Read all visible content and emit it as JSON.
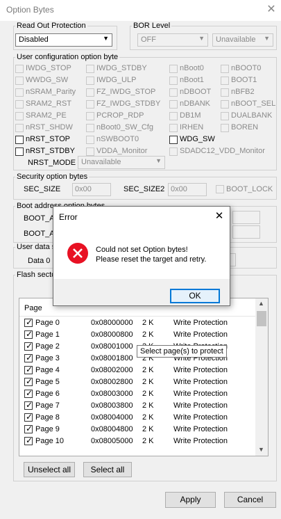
{
  "window": {
    "title": "Option Bytes",
    "close_glyph": "✕"
  },
  "read_out_protection": {
    "label": "Read Out Protection",
    "value": "Disabled"
  },
  "bor_level": {
    "label": "BOR Level",
    "value1": "OFF",
    "value2": "Unavailable"
  },
  "user_config": {
    "label": "User configuration option byte",
    "options": [
      "IWDG_STOP",
      "IWDG_STDBY",
      "nBoot0",
      "nBOOT0",
      "WWDG_SW",
      "IWDG_ULP",
      "nBoot1",
      "BOOT1",
      "nSRAM_Parity",
      "FZ_IWDG_STOP",
      "nDBOOT",
      "nBFB2",
      "SRAM2_RST",
      "FZ_IWDG_STDBY",
      "nDBANK",
      "nBOOT_SEL",
      "SRAM2_PE",
      "PCROP_RDP",
      "DB1M",
      "DUALBANK",
      "nRST_SHDW",
      "nBoot0_SW_Cfg",
      "IRHEN",
      "BOREN",
      "nRST_STOP",
      "nSWBOOT0",
      "WDG_SW",
      "",
      "nRST_STDBY",
      "VDDA_Monitor",
      "SDADC12_VDD_Monitor",
      ""
    ],
    "nrst_mode_label": "NRST_MODE",
    "nrst_mode_value": "Unavailable"
  },
  "security": {
    "label": "Security option bytes",
    "sec_size_label": "SEC_SIZE",
    "sec_size_value": "0x00",
    "sec_size2_label": "SEC_SIZE2",
    "sec_size2_value": "0x00",
    "boot_lock_label": "BOOT_LOCK"
  },
  "boot_address": {
    "label": "Boot address option bytes",
    "row1_label": "BOOT_A",
    "row2_label": "BOOT_A"
  },
  "user_data": {
    "label": "User data s",
    "row_label": "Data 0"
  },
  "flash_sectors": {
    "label": "Flash secto",
    "col_page": "Page",
    "rows": [
      {
        "page": "Page 0",
        "address": "0x08000000",
        "size": "2 K",
        "protection": "Write Protection"
      },
      {
        "page": "Page 1",
        "address": "0x08000800",
        "size": "2 K",
        "protection": "Write Protection"
      },
      {
        "page": "Page 2",
        "address": "0x08001000",
        "size": "2 K",
        "protection": "Write Protection"
      },
      {
        "page": "Page 3",
        "address": "0x08001800",
        "size": "2 K",
        "protection": "Write Protection"
      },
      {
        "page": "Page 4",
        "address": "0x08002000",
        "size": "2 K",
        "protection": "Write Protection"
      },
      {
        "page": "Page 5",
        "address": "0x08002800",
        "size": "2 K",
        "protection": "Write Protection"
      },
      {
        "page": "Page 6",
        "address": "0x08003000",
        "size": "2 K",
        "protection": "Write Protection"
      },
      {
        "page": "Page 7",
        "address": "0x08003800",
        "size": "2 K",
        "protection": "Write Protection"
      },
      {
        "page": "Page 8",
        "address": "0x08004000",
        "size": "2 K",
        "protection": "Write Protection"
      },
      {
        "page": "Page 9",
        "address": "0x08004800",
        "size": "2 K",
        "protection": "Write Protection"
      },
      {
        "page": "Page 10",
        "address": "0x08005000",
        "size": "2 K",
        "protection": "Write Protection"
      }
    ],
    "tooltip": "Select page(s) to protect",
    "unselect_all": "Unselect all",
    "select_all": "Select all"
  },
  "buttons": {
    "apply": "Apply",
    "cancel": "Cancel"
  },
  "error_dialog": {
    "title": "Error",
    "close_glyph": "✕",
    "message_line1": "Could not set Option bytes!",
    "message_line2": "Please reset the target and retry.",
    "ok": "OK",
    "icon": "error-icon",
    "icon_color": "#e81123"
  },
  "colors": {
    "accent": "#0078d7",
    "error": "#e81123"
  }
}
